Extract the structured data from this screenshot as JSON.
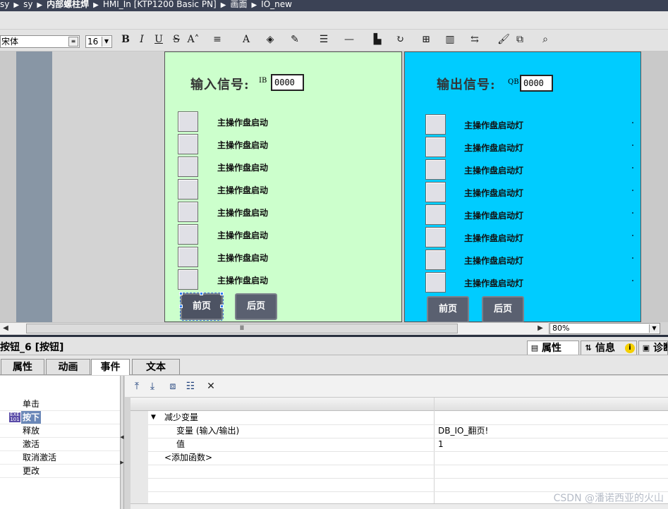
{
  "breadcrumb": [
    "sy",
    "sy",
    "内部螺柱焊",
    "HMI_In [KTP1200 Basic PN]",
    "画面",
    "IO_new"
  ],
  "format_toolbar": {
    "font_name": "宋体",
    "font_size": "16",
    "tools": [
      {
        "icon": "bold-icon",
        "glyph": "B"
      },
      {
        "icon": "italic-icon",
        "glyph": "I"
      },
      {
        "icon": "underline-icon",
        "glyph": "U"
      },
      {
        "icon": "strikethrough-icon",
        "glyph": "S"
      },
      {
        "icon": "font-size-icon",
        "glyph": "A˄"
      },
      {
        "icon": "align-icon",
        "glyph": "≡"
      },
      {
        "icon": "font-color-icon",
        "glyph": "A"
      },
      {
        "icon": "fill-color-icon",
        "glyph": "◈"
      },
      {
        "icon": "line-color-icon",
        "glyph": "✎"
      },
      {
        "icon": "line-style-icon",
        "glyph": "☰"
      },
      {
        "icon": "line-width-icon",
        "glyph": "—"
      },
      {
        "icon": "align-objects-icon",
        "glyph": "▙"
      },
      {
        "icon": "rotate-icon",
        "glyph": "↻"
      },
      {
        "icon": "distribute-icon",
        "glyph": "⊞"
      },
      {
        "icon": "column-icon",
        "glyph": "▥"
      },
      {
        "icon": "same-size-icon",
        "glyph": "⇆"
      },
      {
        "icon": "format-painter-icon",
        "glyph": "🖌"
      },
      {
        "icon": "layers-icon",
        "glyph": "⧉"
      },
      {
        "icon": "zoom-selection-icon",
        "glyph": "⌕"
      }
    ]
  },
  "input_panel": {
    "title": "输入信号:",
    "tag": "IB",
    "value": "0000",
    "rows": [
      "主操作盘启动",
      "主操作盘启动",
      "主操作盘启动",
      "主操作盘启动",
      "主操作盘启动",
      "主操作盘启动",
      "主操作盘启动",
      "主操作盘启动"
    ],
    "prev_button": "前页",
    "next_button": "后页",
    "color": "#ccffcc"
  },
  "output_panel": {
    "title": "输出信号:",
    "tag": "QB",
    "value": "0000",
    "rows": [
      "主操作盘启动灯",
      "主操作盘启动灯",
      "主操作盘启动灯",
      "主操作盘启动灯",
      "主操作盘启动灯",
      "主操作盘启动灯",
      "主操作盘启动灯",
      "主操作盘启动灯"
    ],
    "prev_button": "前页",
    "next_button": "后页",
    "color": "#00ccff"
  },
  "scroll": {
    "thumb": "Ⅲ",
    "zoom": "80%"
  },
  "inspector": {
    "object_title": "按钮_6 [按钮]",
    "right_tabs": [
      "属性",
      "信息",
      "诊断"
    ],
    "tabs": [
      "属性",
      "动画",
      "事件",
      "文本"
    ],
    "active_tab": "事件",
    "events": [
      "单击",
      "按下",
      "释放",
      "激活",
      "取消激活",
      "更改"
    ],
    "active_event": "按下",
    "function": {
      "name": "减少变量",
      "params": [
        {
          "name": "变量 (输入/输出)",
          "value": "DB_IO_翻页!"
        },
        {
          "name": "值",
          "value": "1"
        }
      ],
      "add_function": "<添加函数>"
    }
  },
  "watermark": "CSDN @潘诺西亚的火山",
  "colors": {
    "accent": "#3b4255",
    "selection": "#6b88b8",
    "button": "#5a6070"
  }
}
